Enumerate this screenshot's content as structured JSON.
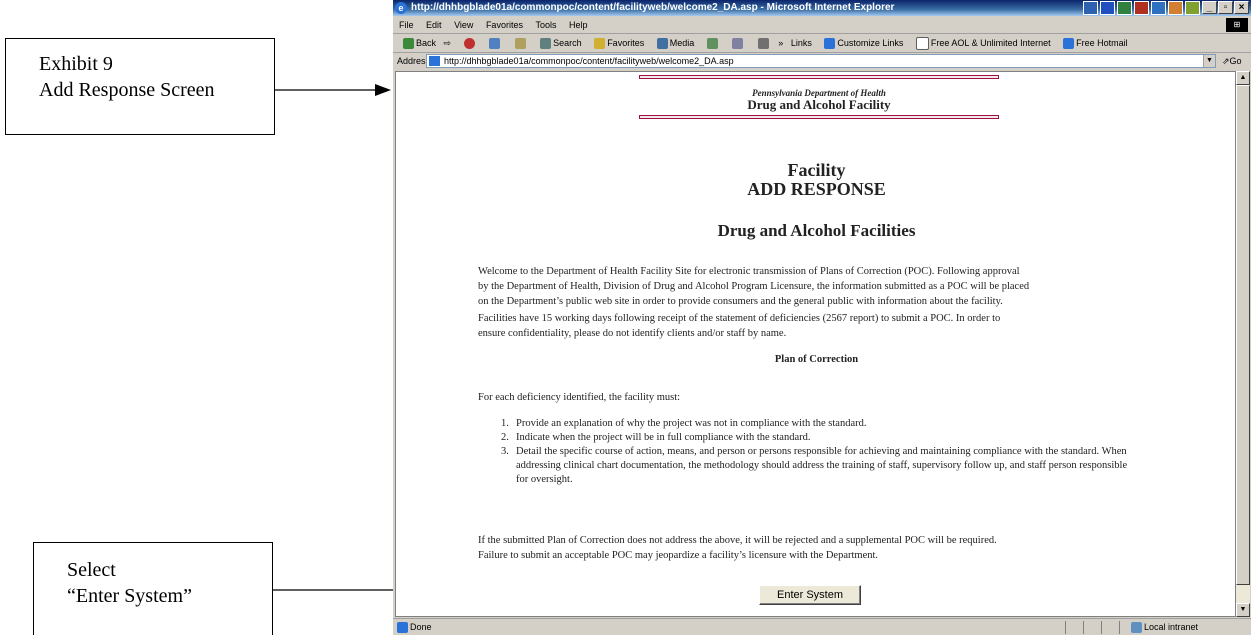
{
  "callouts": {
    "exhibit_line1": "Exhibit 9",
    "exhibit_line2": "Add Response Screen",
    "select_line1": "Select",
    "select_line2": "“Enter System”"
  },
  "browser": {
    "title": "http://dhhbgblade01a/commonpoc/content/facilityweb/welcome2_DA.asp - Microsoft Internet Explorer",
    "window_buttons": [
      "_",
      "▫",
      "×"
    ],
    "menu": [
      "File",
      "Edit",
      "View",
      "Favorites",
      "Tools",
      "Help"
    ],
    "toolbar": [
      "Back",
      "Search",
      "Favorites",
      "Media",
      "Links",
      "Customize Links",
      "Free AOL & Unlimited Internet",
      "Free Hotmail"
    ],
    "address_label": "Address",
    "address_value": "http://dhhbgblade01a/commonpoc/content/facilityweb/welcome2_DA.asp",
    "go_label": "Go",
    "status_text": "Done",
    "status_zone": "Local intranet"
  },
  "page": {
    "dept": "Pennsylvania Department of Health",
    "facility_type": "Drug and Alcohol Facility",
    "heading1": "Facility",
    "heading2": "ADD RESPONSE",
    "heading3": "Drug and Alcohol Facilities",
    "para1_l1": "Welcome to the Department of Health Facility Site for electronic transmission of Plans of Correction (POC). Following approval",
    "para1_l2": "by the Department of Health, Division of Drug and Alcohol Program Licensure, the information submitted as a POC will be placed",
    "para1_l3": "on the Department’s public web site in order to provide consumers and the general public with information about the facility.",
    "para2_l1": "Facilities have 15 working days following receipt of the statement of deficiencies (2567 report) to submit a POC. In order to",
    "para2_l2": "ensure confidentiality, please do not identify clients and/or staff by name.",
    "poc_heading": "Plan of Correction",
    "para3": "For each deficiency identified, the facility must:",
    "list": [
      {
        "num": "1.",
        "text": "Provide an explanation of why the project was not in compliance with the standard."
      },
      {
        "num": "2.",
        "text": "Indicate when the project will be in full compliance with the standard."
      },
      {
        "num": "3.",
        "text": "Detail the specific course of action, means, and person or persons responsible for achieving and maintaining compliance with the standard. When addressing clinical chart documentation, the methodology should address the training of staff, supervisory follow up, and staff person responsible for oversight."
      }
    ],
    "para4_l1": "If the submitted Plan of Correction does not address the above, it will be rejected and a supplemental POC will be required.",
    "para4_l2": "Failure to submit an acceptable POC may jeopardize a facility’s licensure with the Department.",
    "enter_button": "Enter System"
  }
}
